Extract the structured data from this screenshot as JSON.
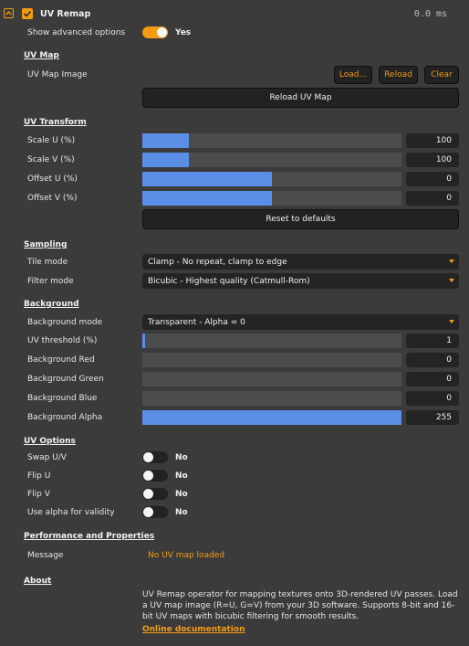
{
  "header": {
    "title": "UV Remap",
    "time": "0.0 ms"
  },
  "advanced": {
    "label": "Show advanced options",
    "value": "Yes"
  },
  "uv_map": {
    "section": "UV Map",
    "image_label": "UV Map Image",
    "load_button": "Load...",
    "reload_button": "Reload",
    "clear_button": "Clear",
    "reload_uv_button": "Reload UV Map"
  },
  "uv_transform": {
    "section": "UV Transform",
    "params": [
      {
        "label": "Scale U (%)",
        "value": "100",
        "fill": 0.18
      },
      {
        "label": "Scale V (%)",
        "value": "100",
        "fill": 0.18
      },
      {
        "label": "Offset U (%)",
        "value": "0",
        "fill": 0.5
      },
      {
        "label": "Offset V (%)",
        "value": "0",
        "fill": 0.5
      }
    ],
    "reset_button": "Reset to defaults"
  },
  "sampling": {
    "section": "Sampling",
    "tile_label": "Tile mode",
    "tile_value": "Clamp - No repeat, clamp to edge",
    "filter_label": "Filter mode",
    "filter_value": "Bicubic - Highest quality (Catmull-Rom)"
  },
  "background": {
    "section": "Background",
    "mode_label": "Background mode",
    "mode_value": "Transparent - Alpha = 0",
    "params": [
      {
        "label": "UV threshold (%)",
        "value": "1",
        "fill": 0.01
      },
      {
        "label": "Background Red",
        "value": "0",
        "fill": 0
      },
      {
        "label": "Background Green",
        "value": "0",
        "fill": 0
      },
      {
        "label": "Background Blue",
        "value": "0",
        "fill": 0
      },
      {
        "label": "Background Alpha",
        "value": "255",
        "fill": 1.0
      }
    ]
  },
  "uv_options": {
    "section": "UV Options",
    "toggles": [
      {
        "label": "Swap U/V",
        "value": "No"
      },
      {
        "label": "Flip U",
        "value": "No"
      },
      {
        "label": "Flip V",
        "value": "No"
      },
      {
        "label": "Use alpha for validity",
        "value": "No"
      }
    ]
  },
  "performance": {
    "section": "Performance and Properties",
    "message_label": "Message",
    "message_value": "No UV map loaded"
  },
  "about": {
    "section": "About",
    "text": "UV Remap operator for mapping textures onto 3D-rendered UV passes. Load a UV map image (R=U, G=V) from your 3D software. Supports 8-bit and 16-bit UV maps with bicubic filtering for smooth results.",
    "link": "Online documentation"
  },
  "colors": {
    "accent": "#f39c12",
    "slider_fill": "#5b8ee6",
    "background": "#3b3b3b"
  }
}
